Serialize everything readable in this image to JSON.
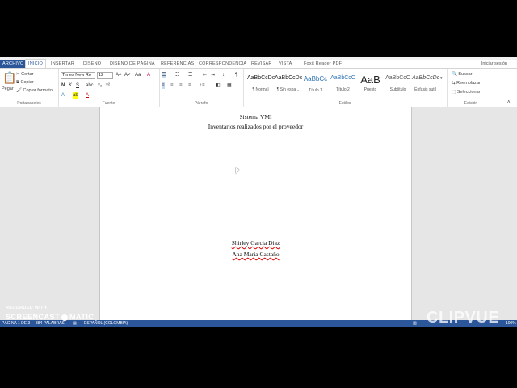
{
  "tabs": [
    "ARCHIVO",
    "INICIO",
    "INSERTAR",
    "DISEÑO",
    "DISEÑO DE PÁGINA",
    "REFERENCIAS",
    "CORRESPONDENCIA",
    "REVISAR",
    "VISTA",
    "Foxit Reader PDF"
  ],
  "signin": "Iniciar sesión",
  "clipboard": {
    "paste": "Pegar",
    "cut": "Cortar",
    "copy": "Copiar",
    "format": "Copiar formato",
    "label": "Portapapeles"
  },
  "font": {
    "name": "Times New Ro",
    "size": "12",
    "label": "Fuente"
  },
  "paragraph": {
    "label": "Párrafo"
  },
  "styles": {
    "items": [
      {
        "preview": "AaBbCcDc",
        "name": "¶ Normal"
      },
      {
        "preview": "AaBbCcDc",
        "name": "¶ Sin espa..."
      },
      {
        "preview": "AaBbCc",
        "name": "Título 1"
      },
      {
        "preview": "AaBbCcC",
        "name": "Título 2"
      },
      {
        "preview": "AaB",
        "name": "Puesto"
      },
      {
        "preview": "AaBbCcC",
        "name": "Subtítulo"
      },
      {
        "preview": "AaBbCcDc",
        "name": "Énfasis sutil"
      }
    ],
    "label": "Estilos"
  },
  "editing": {
    "find": "Buscar",
    "replace": "Reemplazar",
    "select": "Seleccionar",
    "label": "Edición"
  },
  "document": {
    "title": "Sistema VMI",
    "subtitle": "Inventarios realizados por el proveedor",
    "author1": "Shirley Garcia Diaz",
    "author2": "Ana Maria Castaño"
  },
  "status": {
    "page": "PÁGINA 1 DE 3",
    "words": "384 PALABRAS",
    "lang": "ESPAÑOL (COLOMBIA)",
    "zoom": "100%"
  },
  "watermark": {
    "recorded": "RECORDED WITH",
    "brand": "SCREENCAST",
    "brand2": "MATIC",
    "clipvue": "CLIPVUE"
  }
}
